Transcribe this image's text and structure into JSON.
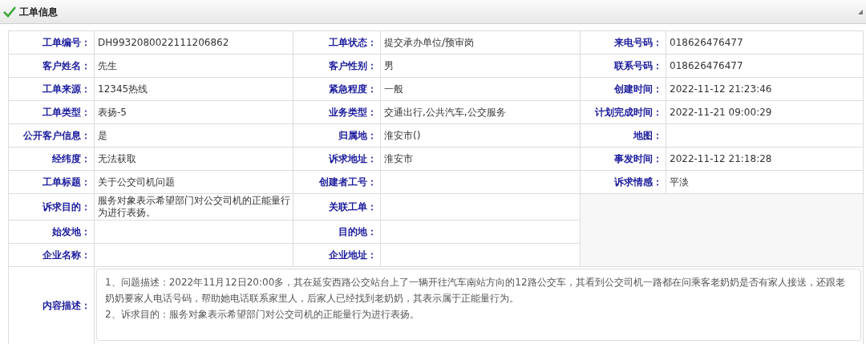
{
  "panel": {
    "title": "工单信息"
  },
  "rows": [
    [
      {
        "label": "工单编号：",
        "value": "DH9932080022111206862"
      },
      {
        "label": "工单状态：",
        "value": "提交承办单位/预审岗"
      },
      {
        "label": "来电号码：",
        "value": "018626476477"
      }
    ],
    [
      {
        "label": "客户姓名：",
        "value": "先生"
      },
      {
        "label": "客户性别：",
        "value": "男"
      },
      {
        "label": "联系号码：",
        "value": "018626476477"
      }
    ],
    [
      {
        "label": "工单来源：",
        "value": "12345热线"
      },
      {
        "label": "紧急程度：",
        "value": "一般"
      },
      {
        "label": "创建时间：",
        "value": "2022-11-12 21:23:46"
      }
    ],
    [
      {
        "label": "工单类型：",
        "value": "表扬-5"
      },
      {
        "label": "业务类型：",
        "value": "交通出行,公共汽车,公交服务"
      },
      {
        "label": "计划完成时间：",
        "value": "2022-11-21 09:00:29"
      }
    ],
    [
      {
        "label": "公开客户信息：",
        "value": "是"
      },
      {
        "label": "归属地：",
        "value": "淮安市()"
      },
      {
        "label": "地图："
      }
    ],
    [
      {
        "label": "经纬度：",
        "value": "无法获取"
      },
      {
        "label": "诉求地址：",
        "value": "淮安市"
      },
      {
        "label": "事发时间：",
        "value": "2022-11-12 21:18:28"
      }
    ],
    [
      {
        "label": "工单标题：",
        "value": "关于公交司机问题"
      },
      {
        "label": "创建者工号："
      },
      {
        "label": "诉求情感：",
        "value": "平淡"
      }
    ],
    [
      {
        "label": "诉求目的：",
        "value": "服务对象表示希望部门对公交司机的正能量行为进行表扬。"
      },
      {
        "label": "关联工单："
      }
    ],
    [
      {
        "label": "始发地："
      },
      {
        "label": "目的地："
      }
    ],
    [
      {
        "label": "企业名称："
      },
      {
        "label": "企业地址："
      }
    ]
  ],
  "content": {
    "label": "内容描述：",
    "lines": [
      "1、问题描述：2022年11月12日20:00多，其在延安西路公交站台上了一辆开往汽车南站方向的12路公交车，其看到公交司机一路都在问乘客老奶奶是否有家人接送，还跟老奶奶要家人电话号码，帮助她电话联系家里人，后家人已经找到老奶奶，其表示属于正能量行为。",
      "2、诉求目的：服务对象表示希望部门对公交司机的正能量行为进行表扬。"
    ]
  }
}
